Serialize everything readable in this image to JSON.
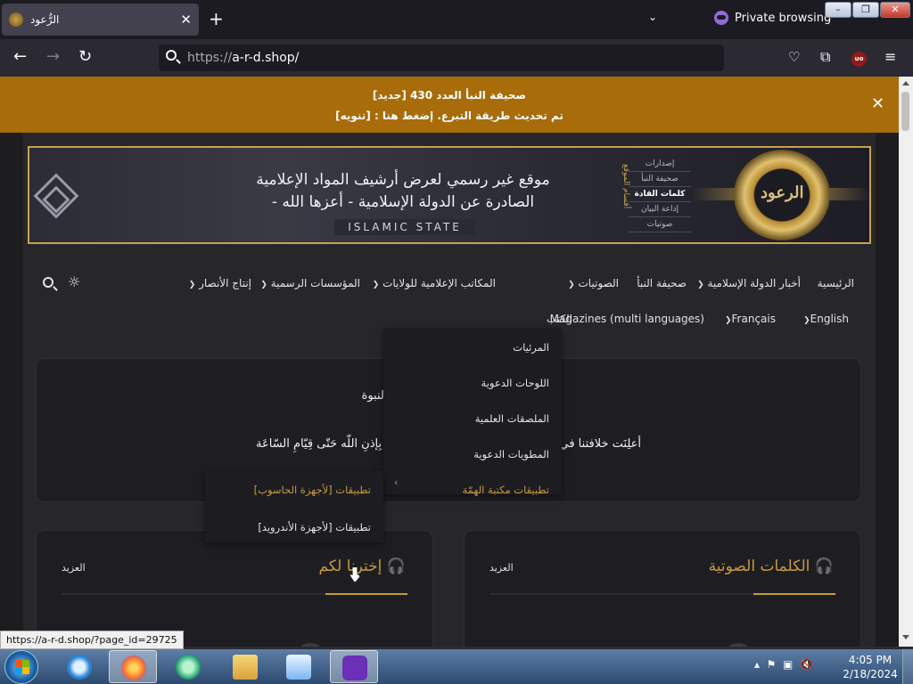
{
  "browser": {
    "tab_title": "الرُّعود",
    "tab_close": "✕",
    "new_tab": "+",
    "list_tabs": "⌄",
    "private_label": "Private browsing",
    "window_min": "–",
    "window_max": "❐",
    "window_close": "✕",
    "url_protocol": "https://",
    "url_host": "a-r-d.shop/",
    "status_url": "https://a-r-d.shop/?page_id=29725"
  },
  "notice": {
    "line1": "[جديد] صحيفة النبأ العدد 430",
    "line2": "[تنويه] : تم تحديث طريقة التبرع. إضغط هنا",
    "close": "✕"
  },
  "banner": {
    "logo_text": "الرعود",
    "sections_title": "أقسام الموقع",
    "sections": [
      "إصدارات",
      "صحيفة النبأ",
      "كلمات القادة",
      "إذاعة البيان",
      "صوتيات"
    ],
    "tagline1": "موقع غير رسمي لعرض أرشيف المواد الإعلامية",
    "tagline2": "الصادرة عن الدولة الإسلامية - أعزها الله -",
    "islamic_state": "ISLAMIC STATE"
  },
  "nav": {
    "home": "الرئيسية",
    "news": "أخبار الدولة الإسلامية",
    "naba": "صحيفة النبأ",
    "audios": "الصوتيات",
    "library": "مكتبة الهمّة",
    "provinces": "المكاتب الإعلامية للولايات",
    "official": "المؤسسات الرسمية",
    "ansar": "إنتاج الأنصار",
    "english": "English",
    "french": "Français",
    "magazines": "Magazines (multi languages)",
    "books": "الكتب"
  },
  "dropdown": {
    "items": [
      "المرئيات",
      "اللوحات الدعوية",
      "الملصقات العلمية",
      "المطويات الدعوية",
      "تطبيقات مكتبة الهمّة"
    ],
    "submenu": [
      "تطبيقات [لأجهزة الحاسوب]",
      "تطبيقات [لأجهزة الأندرويد]"
    ]
  },
  "hadith": {
    "line1": "ج النبوة",
    "line2_right": "أعلِنَت خلافتنا في",
    "line2_left": "ية بِإذنِ اللّه حَتّى قِيّامِ السّاعَة"
  },
  "boxes": {
    "right_title": "الكلمات الصوتية",
    "left_title": "إخترنا لكم",
    "more": "العزيد"
  },
  "taskbar": {
    "time": "4:05 PM",
    "date": "2/18/2024"
  },
  "colors": {
    "notice_bg": "#a86c0a",
    "accent_gold": "#c69a3f",
    "page_bg": "#1d1d20"
  }
}
